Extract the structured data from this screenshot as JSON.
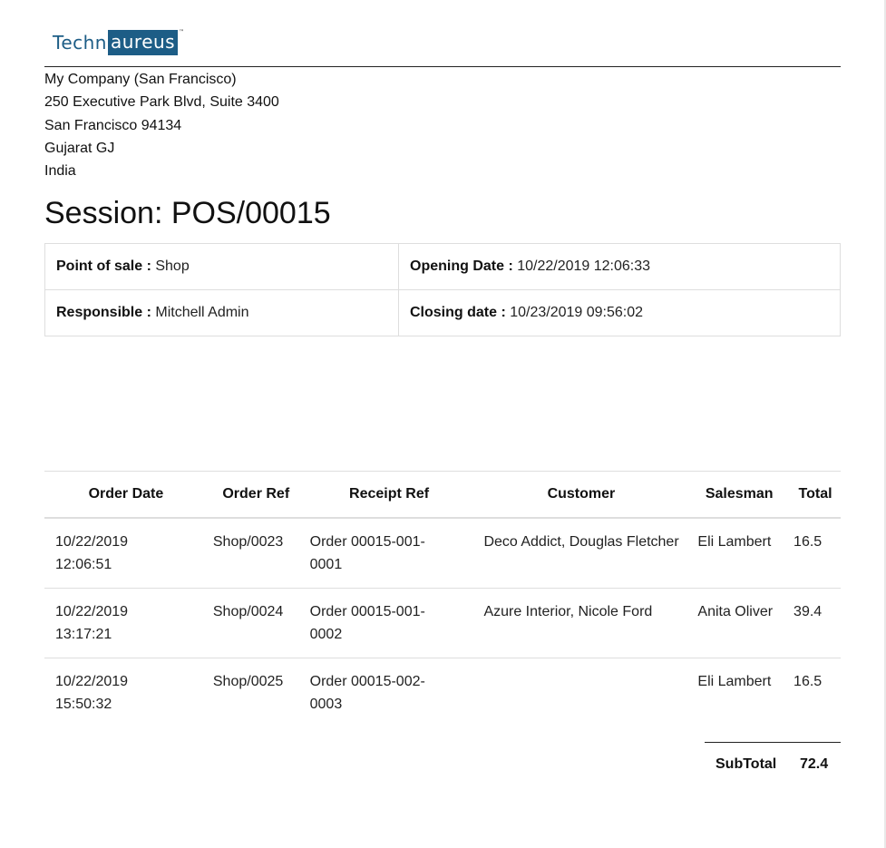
{
  "logo": {
    "left": "Techn",
    "right": "aureus",
    "tm": "™",
    "color": "#1d5d86"
  },
  "company": {
    "lines": [
      "My Company (San Francisco)",
      "250 Executive Park Blvd, Suite 3400",
      "San Francisco 94134",
      "Gujarat GJ",
      "India"
    ]
  },
  "session": {
    "title": "Session: POS/00015"
  },
  "info": {
    "pos_label": "Point of sale :",
    "pos_value": "Shop",
    "opening_label": "Opening Date :",
    "opening_value": "10/22/2019 12:06:33",
    "responsible_label": "Responsible :",
    "responsible_value": "Mitchell Admin",
    "closing_label": "Closing date :",
    "closing_value": "10/23/2019 09:56:02"
  },
  "orders": {
    "headers": [
      "Order Date",
      "Order Ref",
      "Receipt Ref",
      "Customer",
      "Salesman",
      "Total"
    ],
    "rows": [
      {
        "date": "10/22/2019",
        "time": "12:06:51",
        "ref": "Shop/0023",
        "receipt_a": "Order 00015-001-",
        "receipt_b": "0001",
        "customer": "Deco Addict, Douglas Fletcher",
        "salesman": "Eli Lambert",
        "total": "16.5"
      },
      {
        "date": "10/22/2019",
        "time": "13:17:21",
        "ref": "Shop/0024",
        "receipt_a": "Order 00015-001-",
        "receipt_b": "0002",
        "customer": "Azure Interior, Nicole Ford",
        "salesman": "Anita Oliver",
        "total": "39.4"
      },
      {
        "date": "10/22/2019",
        "time": "15:50:32",
        "ref": "Shop/0025",
        "receipt_a": "Order 00015-002-",
        "receipt_b": "0003",
        "customer": "",
        "salesman": "Eli Lambert",
        "total": "16.5"
      }
    ]
  },
  "subtotal": {
    "label": "SubTotal",
    "value": "72.4"
  }
}
